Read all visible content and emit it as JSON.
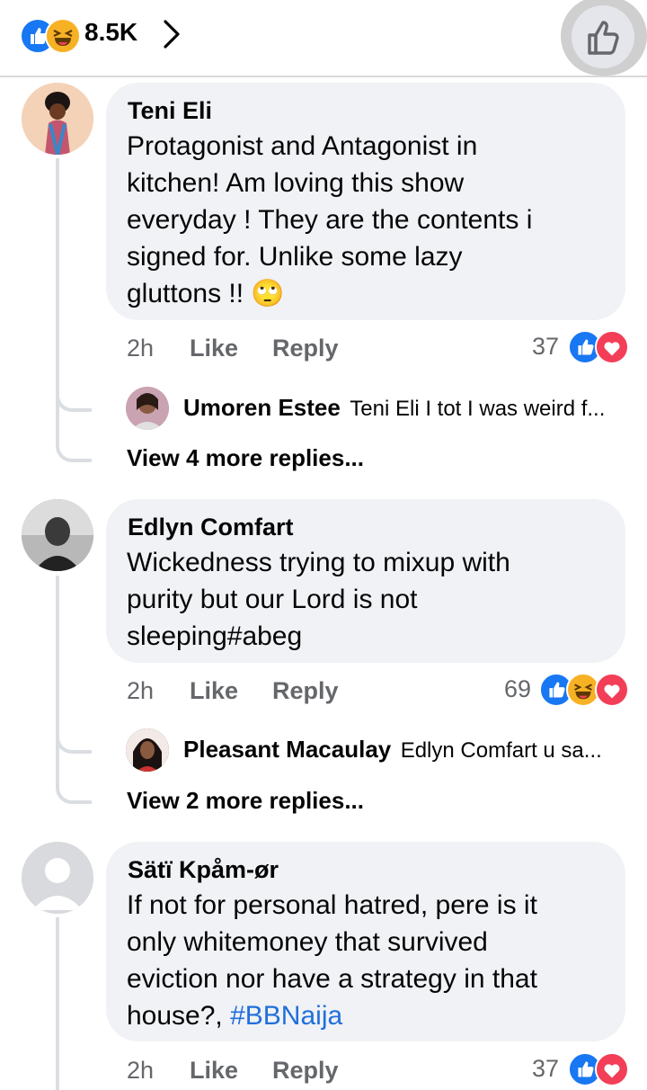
{
  "header": {
    "reaction_count": "8.5K",
    "reactions": [
      "like-icon",
      "haha-icon"
    ],
    "action_icon": "thumbs-up-icon"
  },
  "comments": [
    {
      "author": "Teni Eli",
      "lines": [
        "Protagonist and Antagonist in",
        "kitchen! Am loving this show",
        "everyday !  They are the  contents i",
        "signed for. Unlike some lazy",
        "gluttons !! 🙄"
      ],
      "time": "2h",
      "like": "Like",
      "reply": "Reply",
      "reaction_count": "37",
      "reactions": [
        "like-icon",
        "love-icon"
      ],
      "reply_preview": {
        "author": "Umoren Estee",
        "text": "Teni Eli I tot I was weird f..."
      },
      "more_replies": "View 4 more replies..."
    },
    {
      "author": "Edlyn Comfart",
      "lines": [
        "Wickedness trying to mixup with",
        "purity but our Lord is not",
        "sleeping#abeg"
      ],
      "time": "2h",
      "like": "Like",
      "reply": "Reply",
      "reaction_count": "69",
      "reactions": [
        "like-icon",
        "haha-icon",
        "love-icon"
      ],
      "reply_preview": {
        "author": "Pleasant Macaulay",
        "text": "Edlyn Comfart  u sa..."
      },
      "more_replies": "View 2 more replies..."
    },
    {
      "author": "Sätï Kpåm-ør",
      "lines": [
        "If not for personal hatred, pere is it",
        "only whitemoney that survived",
        "eviction nor have a strategy in that",
        "house?, "
      ],
      "hashtag": "#BBNaija",
      "time": "2h",
      "like": "Like",
      "reply": "Reply",
      "reaction_count": "37",
      "reactions": [
        "like-icon",
        "love-icon"
      ]
    }
  ],
  "colors": {
    "like": "#1877f2",
    "love": "#f33e58",
    "haha": "#f7b125",
    "bubble": "#f0f2f5",
    "meta": "#65676b",
    "link": "#216fdb"
  }
}
